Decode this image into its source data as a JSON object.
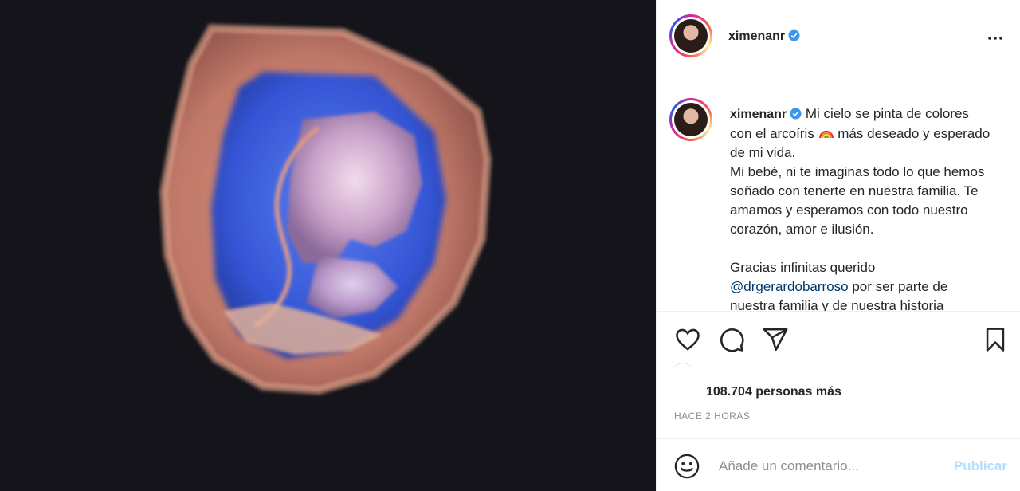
{
  "post": {
    "media_alt": "ultrasonido 3D",
    "username": "ximenanr",
    "verified": true
  },
  "caption": {
    "username": "ximenanr",
    "text_part1": " Mi cielo se pinta de colores con el arcoíris ",
    "emoji": "rainbow-icon",
    "text_part2": " más deseado y esperado de mi vida.\nMi bebé, ni te imaginas todo lo que hemos soñado con tenerte en nuestra familia. Te amamos y esperamos con todo nuestro corazón, amor e ilusión.\n\nGracias infinitas querido\n",
    "mention": "@drgerardobarroso",
    "text_part3": " por ser parte de nuestra familia y de nuestra historia"
  },
  "likes": {
    "text": "108.704 personas más"
  },
  "timestamp": "HACE 2 HORAS",
  "comment": {
    "placeholder": "Añade un comentario...",
    "publish_label": "Publicar"
  },
  "colors": {
    "verified": "#3897f0",
    "mention": "#00376b",
    "publish_disabled": "#b2dffc",
    "media_bg": "#14141a"
  }
}
